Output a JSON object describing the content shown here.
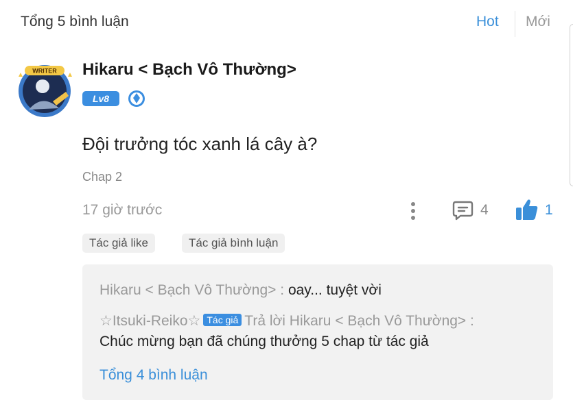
{
  "header": {
    "total_label": "Tổng 5 bình luận",
    "sort_hot": "Hot",
    "sort_new": "Mới"
  },
  "comment": {
    "username": "Hikaru < Bạch Vô Thường>",
    "avatar_badge_text": "WRITER",
    "level": "Lv8",
    "content": "Đội trưởng tóc xanh lá cây à?",
    "chapter": "Chap 2",
    "time": "17 giờ trước",
    "reply_count": "4",
    "like_count": "1",
    "tags": [
      "Tác giả like",
      "Tác giả bình luận"
    ]
  },
  "replies": {
    "first_author": "Hikaru < Bạch Vô Thường> :",
    "first_text": "oay... tuyệt vời",
    "second_author": "☆Itsuki-Reiko☆",
    "second_badge": "Tác giả",
    "second_reply_to": "Trả lời Hikaru < Bạch Vô Thường> :",
    "second_text": "Chúc mừng bạn đã chúng thưởng 5 chap từ tác giả",
    "view_all": "Tổng 4 bình luận"
  },
  "colors": {
    "accent": "#3a8fd9",
    "badge": "#3b8ee0",
    "muted": "#999999",
    "reply_bg": "#f2f2f2"
  },
  "icons": {
    "more": "vertical-dots-icon",
    "reply": "comment-bubble-icon",
    "like": "thumbs-up-icon",
    "level_gem": "diamond-gem-icon"
  }
}
